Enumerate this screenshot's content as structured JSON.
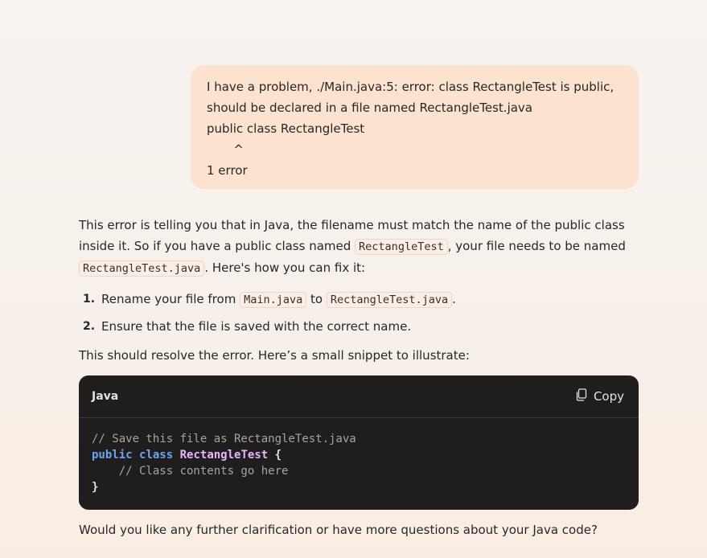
{
  "user_message": {
    "lines": [
      "I have a problem, ./Main.java:5: error: class RectangleTest is public,",
      "should be declared in a file named RectangleTest.java",
      "public class RectangleTest",
      "       ^",
      "1 error"
    ]
  },
  "assistant": {
    "intro": {
      "t1": "This error is telling you that in Java, the filename must match the name of the public class inside it. So if you have a public class named ",
      "c1": "RectangleTest",
      "t2": ", your file needs to be named ",
      "c2": "RectangleTest.java",
      "t3": ". Here's how you can fix it:"
    },
    "steps": [
      {
        "num": "1.",
        "t1": "Rename your file from ",
        "c1": "Main.java",
        "t2": " to ",
        "c2": "RectangleTest.java",
        "t3": "."
      },
      {
        "num": "2.",
        "text": "Ensure that the file is saved with the correct name."
      }
    ],
    "after_list": "This should resolve the error. Here’s a small snippet to illustrate:",
    "code_block": {
      "language": "Java",
      "copy_label": "Copy",
      "line1": "// Save this file as RectangleTest.java",
      "kw_public": "public",
      "kw_class": "class",
      "class_name": "RectangleTest",
      "open_brace": "{",
      "line3": "    // Class contents go here",
      "close_brace": "}"
    },
    "closing": "Would you like any further clarification or have more questions about your Java code?"
  },
  "colors": {
    "user_bubble": "#fce3cf",
    "code_bg": "#1f1e1d",
    "keyword": "#6aa5f5",
    "class_name": "#e8b6ff",
    "comment": "#a9a39c"
  }
}
